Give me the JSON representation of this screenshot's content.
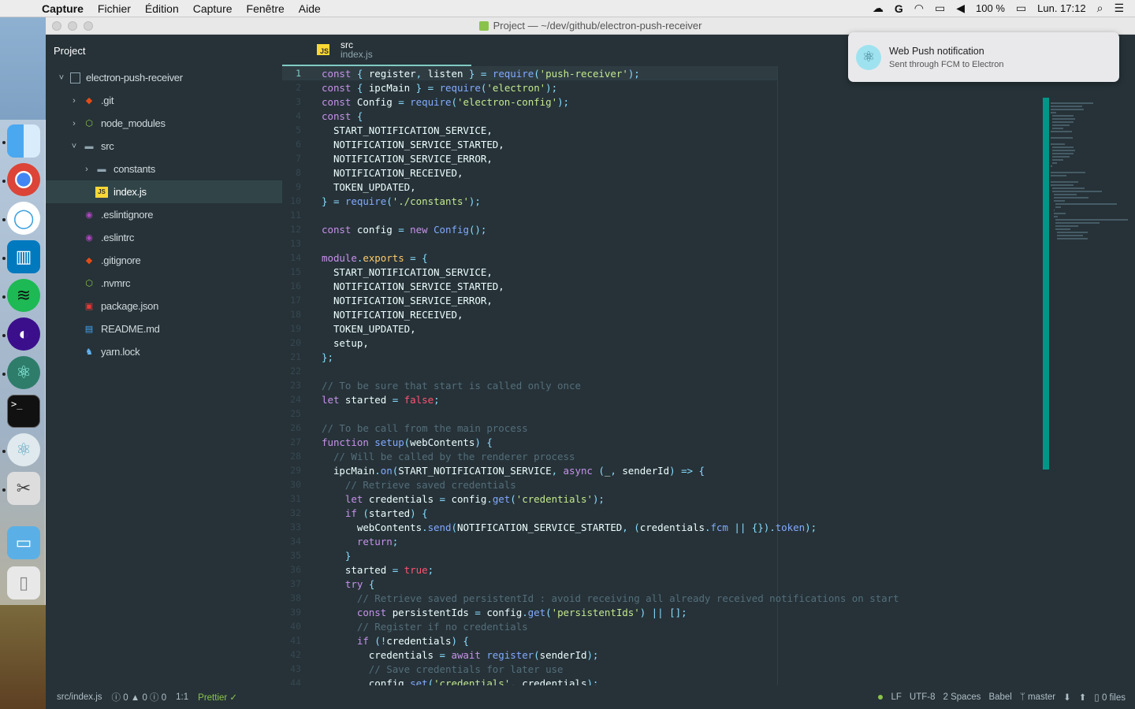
{
  "menubar": {
    "app": "Capture",
    "menus": [
      "Fichier",
      "Édition",
      "Capture",
      "Fenêtre",
      "Aide"
    ],
    "battery": "100 %",
    "clock": "Lun. 17:12"
  },
  "window": {
    "title": "Project — ~/dev/github/electron-push-receiver"
  },
  "treeview": {
    "header": "Project",
    "items": [
      {
        "label": "electron-push-receiver",
        "icon": "repo-icon",
        "chev": "˅"
      },
      {
        "label": ".git",
        "icon": "git-icon",
        "chev": "›"
      },
      {
        "label": "node_modules",
        "icon": "node-icon",
        "chev": "›"
      },
      {
        "label": "src",
        "icon": "folder-icon",
        "chev": "˅"
      },
      {
        "label": "constants",
        "icon": "folder-icon",
        "chev": "›"
      },
      {
        "label": "index.js",
        "icon": "js-icon",
        "chev": ""
      },
      {
        "label": ".eslintignore",
        "icon": "eslint-icon",
        "chev": ""
      },
      {
        "label": ".eslintrc",
        "icon": "eslint-icon",
        "chev": ""
      },
      {
        "label": ".gitignore",
        "icon": "git-icon",
        "chev": ""
      },
      {
        "label": ".nvmrc",
        "icon": "node-icon",
        "chev": ""
      },
      {
        "label": "package.json",
        "icon": "npm-icon",
        "chev": ""
      },
      {
        "label": "README.md",
        "icon": "readme-icon",
        "chev": ""
      },
      {
        "label": "yarn.lock",
        "icon": "yarn-icon",
        "chev": ""
      }
    ]
  },
  "tab": {
    "dir": "src",
    "file": "index.js",
    "badge": "JS"
  },
  "editor": {
    "line_numbers": [
      "1",
      "2",
      "3",
      "4",
      "5",
      "6",
      "7",
      "8",
      "9",
      "10",
      "11",
      "12",
      "13",
      "14",
      "15",
      "16",
      "17",
      "18",
      "19",
      "20",
      "21",
      "22",
      "23",
      "24",
      "25",
      "26",
      "27",
      "28",
      "29",
      "30",
      "31",
      "32",
      "33",
      "34",
      "35",
      "36",
      "37",
      "38",
      "39",
      "40",
      "41",
      "42",
      "43",
      "44"
    ],
    "lines": [
      [
        [
          "kw",
          "const"
        ],
        [
          "op",
          " { "
        ],
        [
          "",
          "register"
        ],
        [
          "op",
          ", "
        ],
        [
          "",
          "listen"
        ],
        [
          "op",
          " } = "
        ],
        [
          "fn",
          "require"
        ],
        [
          "op",
          "("
        ],
        [
          "str",
          "'push-receiver'"
        ],
        [
          "op",
          ");"
        ]
      ],
      [
        [
          "kw",
          "const"
        ],
        [
          "op",
          " { "
        ],
        [
          "",
          "ipcMain"
        ],
        [
          "op",
          " } = "
        ],
        [
          "fn",
          "require"
        ],
        [
          "op",
          "("
        ],
        [
          "str",
          "'electron'"
        ],
        [
          "op",
          ");"
        ]
      ],
      [
        [
          "kw",
          "const"
        ],
        [
          "",
          " Config "
        ],
        [
          "op",
          "= "
        ],
        [
          "fn",
          "require"
        ],
        [
          "op",
          "("
        ],
        [
          "str",
          "'electron-config'"
        ],
        [
          "op",
          ");"
        ]
      ],
      [
        [
          "kw",
          "const"
        ],
        [
          "op",
          " {"
        ]
      ],
      [
        [
          "",
          "  START_NOTIFICATION_SERVICE,"
        ]
      ],
      [
        [
          "",
          "  NOTIFICATION_SERVICE_STARTED,"
        ]
      ],
      [
        [
          "",
          "  NOTIFICATION_SERVICE_ERROR,"
        ]
      ],
      [
        [
          "",
          "  NOTIFICATION_RECEIVED,"
        ]
      ],
      [
        [
          "",
          "  TOKEN_UPDATED,"
        ]
      ],
      [
        [
          "op",
          "} = "
        ],
        [
          "fn",
          "require"
        ],
        [
          "op",
          "("
        ],
        [
          "str",
          "'./constants'"
        ],
        [
          "op",
          ");"
        ]
      ],
      [
        [
          "",
          ""
        ]
      ],
      [
        [
          "kw",
          "const"
        ],
        [
          "",
          " config "
        ],
        [
          "op",
          "= "
        ],
        [
          "kw",
          "new"
        ],
        [
          "fn",
          " Config"
        ],
        [
          "op",
          "();"
        ]
      ],
      [
        [
          "",
          ""
        ]
      ],
      [
        [
          "kw",
          "module"
        ],
        [
          "op",
          "."
        ],
        [
          "prop",
          "exports"
        ],
        [
          "op",
          " = {"
        ]
      ],
      [
        [
          "",
          "  START_NOTIFICATION_SERVICE,"
        ]
      ],
      [
        [
          "",
          "  NOTIFICATION_SERVICE_STARTED,"
        ]
      ],
      [
        [
          "",
          "  NOTIFICATION_SERVICE_ERROR,"
        ]
      ],
      [
        [
          "",
          "  NOTIFICATION_RECEIVED,"
        ]
      ],
      [
        [
          "",
          "  TOKEN_UPDATED,"
        ]
      ],
      [
        [
          "",
          "  setup,"
        ]
      ],
      [
        [
          "op",
          "};"
        ]
      ],
      [
        [
          "",
          ""
        ]
      ],
      [
        [
          "cm",
          "// To be sure that start is called only once"
        ]
      ],
      [
        [
          "kw",
          "let"
        ],
        [
          "",
          " started "
        ],
        [
          "op",
          "= "
        ],
        [
          "bool",
          "false"
        ],
        [
          "op",
          ";"
        ]
      ],
      [
        [
          "",
          ""
        ]
      ],
      [
        [
          "cm",
          "// To be call from the main process"
        ]
      ],
      [
        [
          "kw",
          "function"
        ],
        [
          "fn",
          " setup"
        ],
        [
          "op",
          "("
        ],
        [
          "",
          "webContents"
        ],
        [
          "op",
          ") {"
        ]
      ],
      [
        [
          "cm",
          "  // Will be called by the renderer process"
        ]
      ],
      [
        [
          "",
          "  ipcMain"
        ],
        [
          "op",
          "."
        ],
        [
          "fn",
          "on"
        ],
        [
          "op",
          "("
        ],
        [
          "",
          "START_NOTIFICATION_SERVICE"
        ],
        [
          "op",
          ", "
        ],
        [
          "kw",
          "async"
        ],
        [
          "op",
          " ("
        ],
        [
          "",
          "_"
        ],
        [
          "op",
          ", "
        ],
        [
          "",
          "senderId"
        ],
        [
          "op",
          ") => {"
        ]
      ],
      [
        [
          "cm",
          "    // Retrieve saved credentials"
        ]
      ],
      [
        [
          "kw",
          "    let"
        ],
        [
          "",
          " credentials "
        ],
        [
          "op",
          "= "
        ],
        [
          "",
          "config"
        ],
        [
          "op",
          "."
        ],
        [
          "fn",
          "get"
        ],
        [
          "op",
          "("
        ],
        [
          "str",
          "'credentials'"
        ],
        [
          "op",
          ");"
        ]
      ],
      [
        [
          "kw",
          "    if"
        ],
        [
          "op",
          " ("
        ],
        [
          "",
          "started"
        ],
        [
          "op",
          ") {"
        ]
      ],
      [
        [
          "",
          "      webContents"
        ],
        [
          "op",
          "."
        ],
        [
          "fn",
          "send"
        ],
        [
          "op",
          "("
        ],
        [
          "",
          "NOTIFICATION_SERVICE_STARTED"
        ],
        [
          "op",
          ", ("
        ],
        [
          "",
          "credentials"
        ],
        [
          "op",
          "."
        ],
        [
          "fn",
          "fcm"
        ],
        [
          "op",
          " || {})."
        ],
        [
          "fn",
          "token"
        ],
        [
          "op",
          ");"
        ]
      ],
      [
        [
          "kw",
          "      return"
        ],
        [
          "op",
          ";"
        ]
      ],
      [
        [
          "op",
          "    }"
        ]
      ],
      [
        [
          "",
          "    started "
        ],
        [
          "op",
          "= "
        ],
        [
          "bool",
          "true"
        ],
        [
          "op",
          ";"
        ]
      ],
      [
        [
          "kw",
          "    try"
        ],
        [
          "op",
          " {"
        ]
      ],
      [
        [
          "cm",
          "      // Retrieve saved persistentId : avoid receiving all already received notifications on start"
        ]
      ],
      [
        [
          "kw",
          "      const"
        ],
        [
          "",
          " persistentIds "
        ],
        [
          "op",
          "= "
        ],
        [
          "",
          "config"
        ],
        [
          "op",
          "."
        ],
        [
          "fn",
          "get"
        ],
        [
          "op",
          "("
        ],
        [
          "str",
          "'persistentIds'"
        ],
        [
          "op",
          ") || [];"
        ]
      ],
      [
        [
          "cm",
          "      // Register if no credentials"
        ]
      ],
      [
        [
          "kw",
          "      if"
        ],
        [
          "op",
          " (!"
        ],
        [
          "",
          "credentials"
        ],
        [
          "op",
          ") {"
        ]
      ],
      [
        [
          "",
          "        credentials "
        ],
        [
          "op",
          "= "
        ],
        [
          "kw",
          "await"
        ],
        [
          "fn",
          " register"
        ],
        [
          "op",
          "("
        ],
        [
          "",
          "senderId"
        ],
        [
          "op",
          ");"
        ]
      ],
      [
        [
          "cm",
          "        // Save credentials for later use"
        ]
      ],
      [
        [
          "",
          "        config"
        ],
        [
          "op",
          "."
        ],
        [
          "fn",
          "set"
        ],
        [
          "op",
          "("
        ],
        [
          "str",
          "'credentials'"
        ],
        [
          "op",
          ", "
        ],
        [
          "",
          "credentials"
        ],
        [
          "op",
          ");"
        ]
      ]
    ]
  },
  "notification": {
    "title": "Web Push notification",
    "subtitle": "Sent through FCM to Electron"
  },
  "statusbar": {
    "path": "src/index.js",
    "errors": "0",
    "warnings": "0",
    "infos": "0",
    "cursor": "1:1",
    "prettier": "Prettier ✓",
    "line_ending": "LF",
    "encoding": "UTF-8",
    "indent": "2 Spaces",
    "grammar": "Babel",
    "branch": "master",
    "files": "0 files"
  },
  "colors": {
    "accent": "#80cbc4",
    "scrollbar": "#009688",
    "editor_bg": "#263238"
  }
}
